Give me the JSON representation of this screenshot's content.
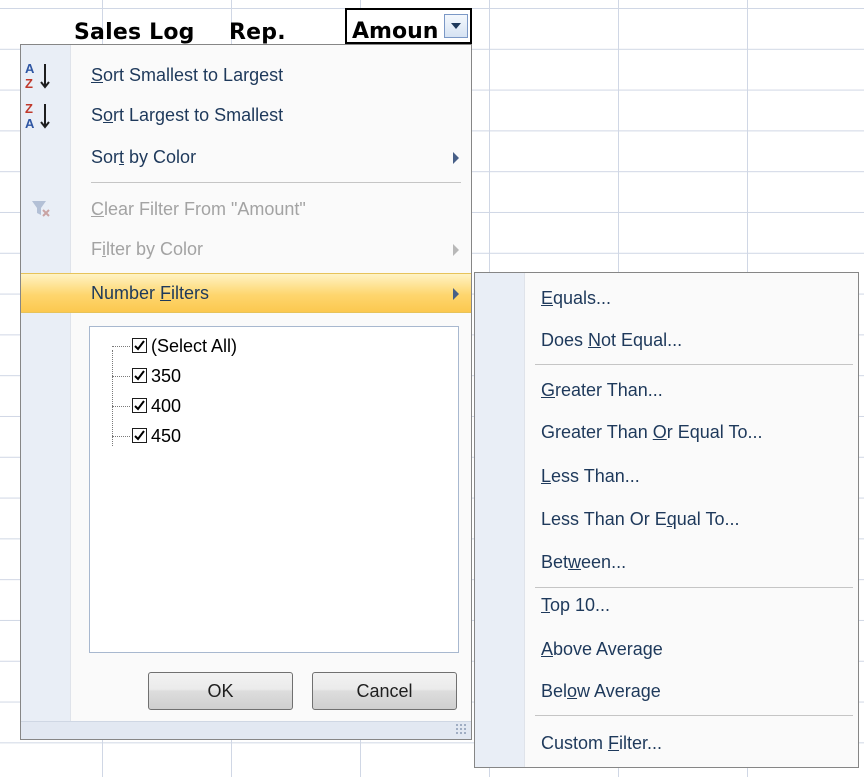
{
  "sheet": {
    "headers": [
      "Sales Log",
      "Rep.",
      "Amoun"
    ]
  },
  "menu": {
    "sort_asc": {
      "pre": "",
      "u": "S",
      "post": "ort Smallest to Largest"
    },
    "sort_desc": {
      "pre": "S",
      "u": "o",
      "post": "rt Largest to Smallest"
    },
    "sort_color": {
      "pre": "Sor",
      "u": "t",
      "post": " by Color"
    },
    "clear_filter": {
      "pre": "",
      "u": "C",
      "post": "lear Filter From \"Amount\""
    },
    "filter_color": {
      "pre": "F",
      "u": "i",
      "post": "lter by Color"
    },
    "number_filters": {
      "pre": "Number ",
      "u": "F",
      "post": "ilters"
    },
    "checklist": [
      "(Select All)",
      "350",
      "400",
      "450"
    ],
    "ok_label": "OK",
    "cancel_label": "Cancel"
  },
  "submenu": {
    "items": [
      {
        "pre": "",
        "u": "E",
        "post": "quals..."
      },
      {
        "pre": "Does ",
        "u": "N",
        "post": "ot Equal..."
      },
      {
        "pre": "",
        "u": "G",
        "post": "reater Than..."
      },
      {
        "pre": "Greater Than ",
        "u": "O",
        "post": "r Equal To..."
      },
      {
        "pre": "",
        "u": "L",
        "post": "ess Than..."
      },
      {
        "pre": "Less Than Or E",
        "u": "q",
        "post": "ual To..."
      },
      {
        "pre": "Bet",
        "u": "w",
        "post": "een..."
      },
      {
        "pre": "",
        "u": "T",
        "post": "op 10..."
      },
      {
        "pre": "",
        "u": "A",
        "post": "bove Average"
      },
      {
        "pre": "Bel",
        "u": "o",
        "post": "w Average"
      },
      {
        "pre": "Custom ",
        "u": "F",
        "post": "ilter..."
      }
    ]
  },
  "colors": {
    "highlight": "#fcc84f",
    "menu_text": "#1e395b",
    "disabled_text": "#a3a3a3",
    "grid": "#d0d7e5"
  }
}
